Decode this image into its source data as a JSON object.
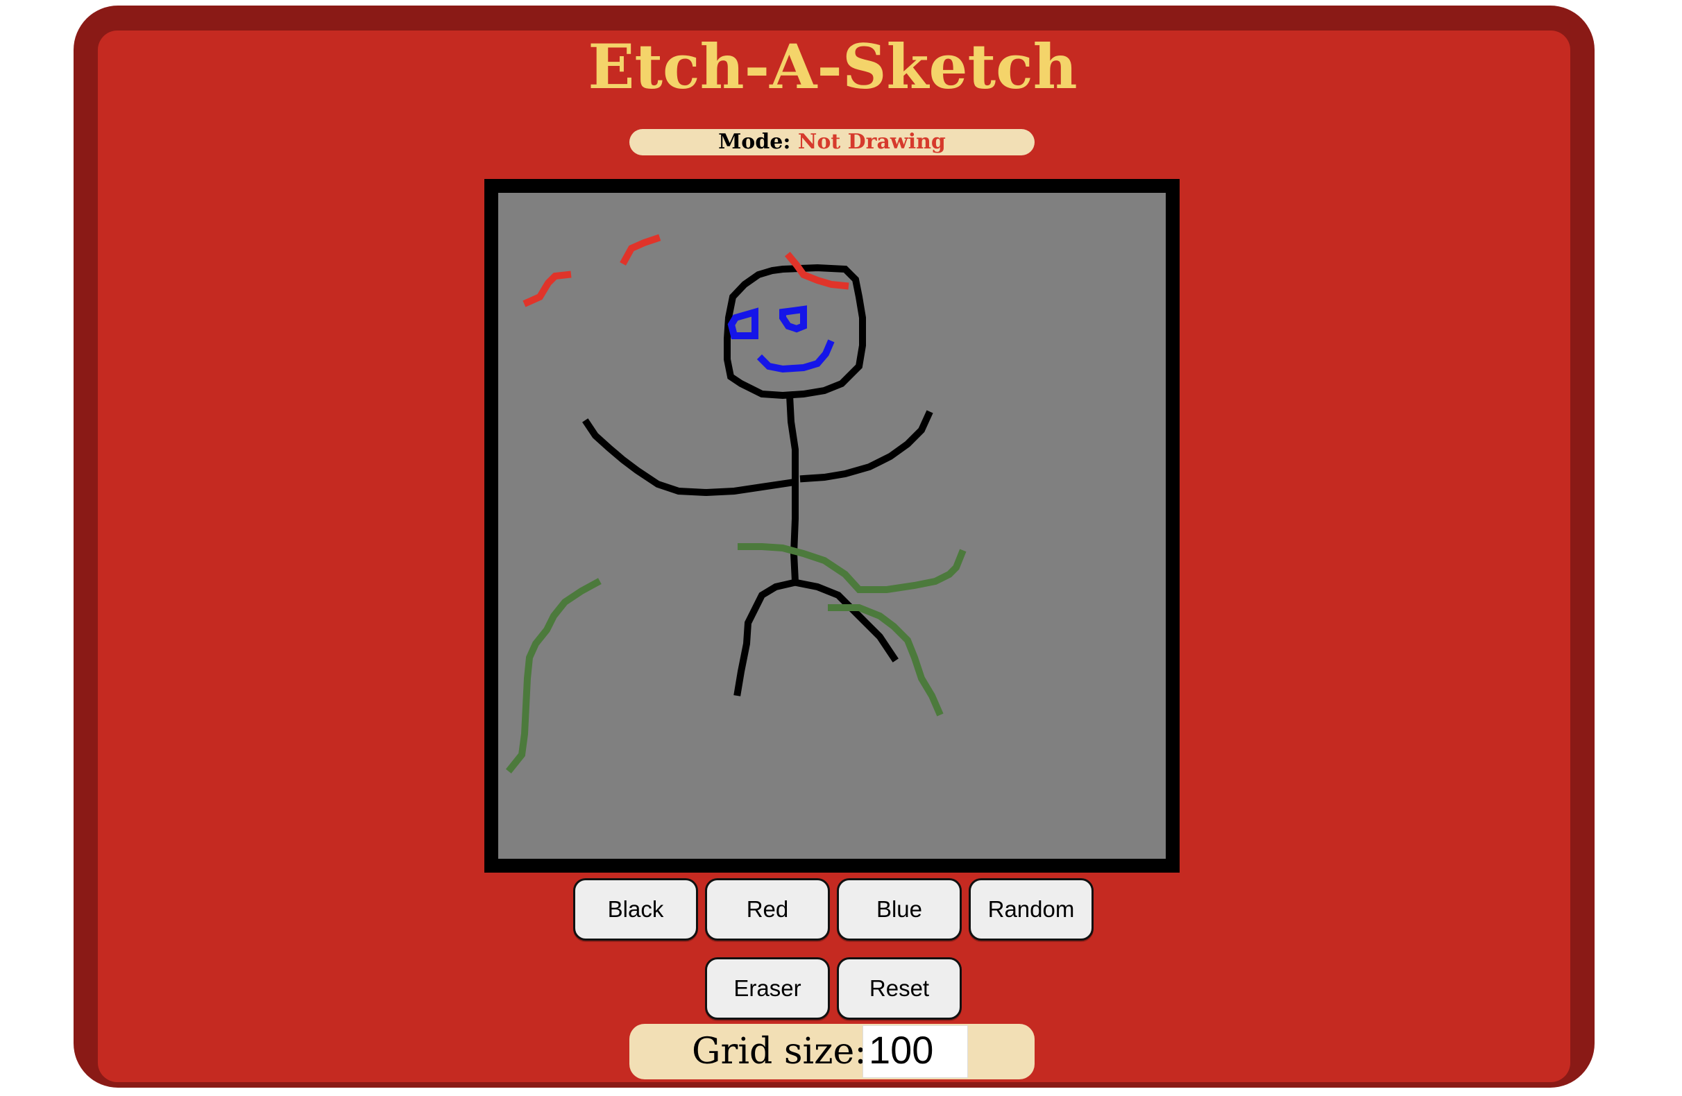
{
  "app": {
    "title": "Etch-A-Sketch"
  },
  "mode": {
    "label": "Mode:",
    "value": "Not Drawing",
    "value_color": "#d63a2c"
  },
  "colors": {
    "frame_dark": "#8a1a16",
    "frame_body": "#c52a21",
    "title": "#f4d46a",
    "pill": "#f2dfb5",
    "canvas_bg": "#808080",
    "ink_black": "#000000",
    "ink_red": "#e0342a",
    "ink_blue": "#1515e8",
    "ink_green": "#4c7a3c"
  },
  "buttons": {
    "black": "Black",
    "red": "Red",
    "blue": "Blue",
    "random": "Random",
    "eraser": "Eraser",
    "reset": "Reset"
  },
  "grid": {
    "label": "Grid size:",
    "value": "100"
  }
}
